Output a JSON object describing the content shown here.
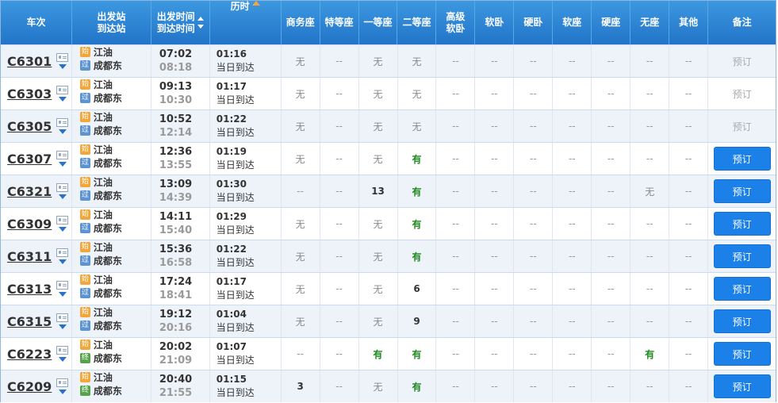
{
  "header": {
    "train": "车次",
    "station_top": "出发站",
    "station_bottom": "到达站",
    "time_top": "出发时间",
    "time_bottom": "到达时间",
    "duration": "历时",
    "seats": [
      "商务座",
      "特等座",
      "一等座",
      "二等座",
      "高级软卧",
      "软卧",
      "硬卧",
      "软座",
      "硬座",
      "无座",
      "其他"
    ],
    "note": "备注"
  },
  "rows": [
    {
      "train": "C6301",
      "from": "江油",
      "to": "成都东",
      "from_badge": "始",
      "to_badge": "过",
      "to_type": "pass",
      "dep": "07:02",
      "arr": "08:18",
      "dur": "01:16",
      "day": "当日到达",
      "seats": [
        "无",
        "--",
        "无",
        "无",
        "--",
        "--",
        "--",
        "--",
        "--",
        "--",
        "--"
      ],
      "book": "预订",
      "bookable": false
    },
    {
      "train": "C6303",
      "from": "江油",
      "to": "成都东",
      "from_badge": "始",
      "to_badge": "过",
      "to_type": "pass",
      "dep": "09:13",
      "arr": "10:30",
      "dur": "01:17",
      "day": "当日到达",
      "seats": [
        "无",
        "--",
        "无",
        "无",
        "--",
        "--",
        "--",
        "--",
        "--",
        "--",
        "--"
      ],
      "book": "预订",
      "bookable": false
    },
    {
      "train": "C6305",
      "from": "江油",
      "to": "成都东",
      "from_badge": "始",
      "to_badge": "过",
      "to_type": "pass",
      "dep": "10:52",
      "arr": "12:14",
      "dur": "01:22",
      "day": "当日到达",
      "seats": [
        "无",
        "--",
        "无",
        "无",
        "--",
        "--",
        "--",
        "--",
        "--",
        "--",
        "--"
      ],
      "book": "预订",
      "bookable": false
    },
    {
      "train": "C6307",
      "from": "江油",
      "to": "成都东",
      "from_badge": "始",
      "to_badge": "过",
      "to_type": "pass",
      "dep": "12:36",
      "arr": "13:55",
      "dur": "01:19",
      "day": "当日到达",
      "seats": [
        "无",
        "--",
        "无",
        "有",
        "--",
        "--",
        "--",
        "--",
        "--",
        "--",
        "--"
      ],
      "book": "预订",
      "bookable": true
    },
    {
      "train": "C6321",
      "from": "江油",
      "to": "成都东",
      "from_badge": "始",
      "to_badge": "过",
      "to_type": "pass",
      "dep": "13:09",
      "arr": "14:39",
      "dur": "01:30",
      "day": "当日到达",
      "seats": [
        "--",
        "--",
        "13",
        "有",
        "--",
        "--",
        "--",
        "--",
        "--",
        "无",
        "--"
      ],
      "book": "预订",
      "bookable": true
    },
    {
      "train": "C6309",
      "from": "江油",
      "to": "成都东",
      "from_badge": "始",
      "to_badge": "过",
      "to_type": "pass",
      "dep": "14:11",
      "arr": "15:40",
      "dur": "01:29",
      "day": "当日到达",
      "seats": [
        "无",
        "--",
        "无",
        "有",
        "--",
        "--",
        "--",
        "--",
        "--",
        "--",
        "--"
      ],
      "book": "预订",
      "bookable": true
    },
    {
      "train": "C6311",
      "from": "江油",
      "to": "成都东",
      "from_badge": "始",
      "to_badge": "过",
      "to_type": "pass",
      "dep": "15:36",
      "arr": "16:58",
      "dur": "01:22",
      "day": "当日到达",
      "seats": [
        "无",
        "--",
        "无",
        "有",
        "--",
        "--",
        "--",
        "--",
        "--",
        "--",
        "--"
      ],
      "book": "预订",
      "bookable": true
    },
    {
      "train": "C6313",
      "from": "江油",
      "to": "成都东",
      "from_badge": "始",
      "to_badge": "过",
      "to_type": "pass",
      "dep": "17:24",
      "arr": "18:41",
      "dur": "01:17",
      "day": "当日到达",
      "seats": [
        "无",
        "--",
        "无",
        "6",
        "--",
        "--",
        "--",
        "--",
        "--",
        "--",
        "--"
      ],
      "book": "预订",
      "bookable": true
    },
    {
      "train": "C6315",
      "from": "江油",
      "to": "成都东",
      "from_badge": "始",
      "to_badge": "过",
      "to_type": "pass",
      "dep": "19:12",
      "arr": "20:16",
      "dur": "01:04",
      "day": "当日到达",
      "seats": [
        "无",
        "--",
        "无",
        "9",
        "--",
        "--",
        "--",
        "--",
        "--",
        "--",
        "--"
      ],
      "book": "预订",
      "bookable": true
    },
    {
      "train": "C6223",
      "from": "江油",
      "to": "成都东",
      "from_badge": "始",
      "to_badge": "终",
      "to_type": "end",
      "dep": "20:02",
      "arr": "21:09",
      "dur": "01:07",
      "day": "当日到达",
      "seats": [
        "--",
        "--",
        "有",
        "有",
        "--",
        "--",
        "--",
        "--",
        "--",
        "有",
        "--"
      ],
      "book": "预订",
      "bookable": true
    },
    {
      "train": "C6209",
      "from": "江油",
      "to": "成都东",
      "from_badge": "始",
      "to_badge": "终",
      "to_type": "end",
      "dep": "20:40",
      "arr": "21:55",
      "dur": "01:15",
      "day": "当日到达",
      "seats": [
        "3",
        "--",
        "无",
        "有",
        "--",
        "--",
        "--",
        "--",
        "--",
        "--",
        "--"
      ],
      "book": "预订",
      "bookable": true
    }
  ],
  "colors": {
    "header_bg": "#2a80d4",
    "book_btn": "#1b80e8",
    "available": "#1f8a1f"
  }
}
